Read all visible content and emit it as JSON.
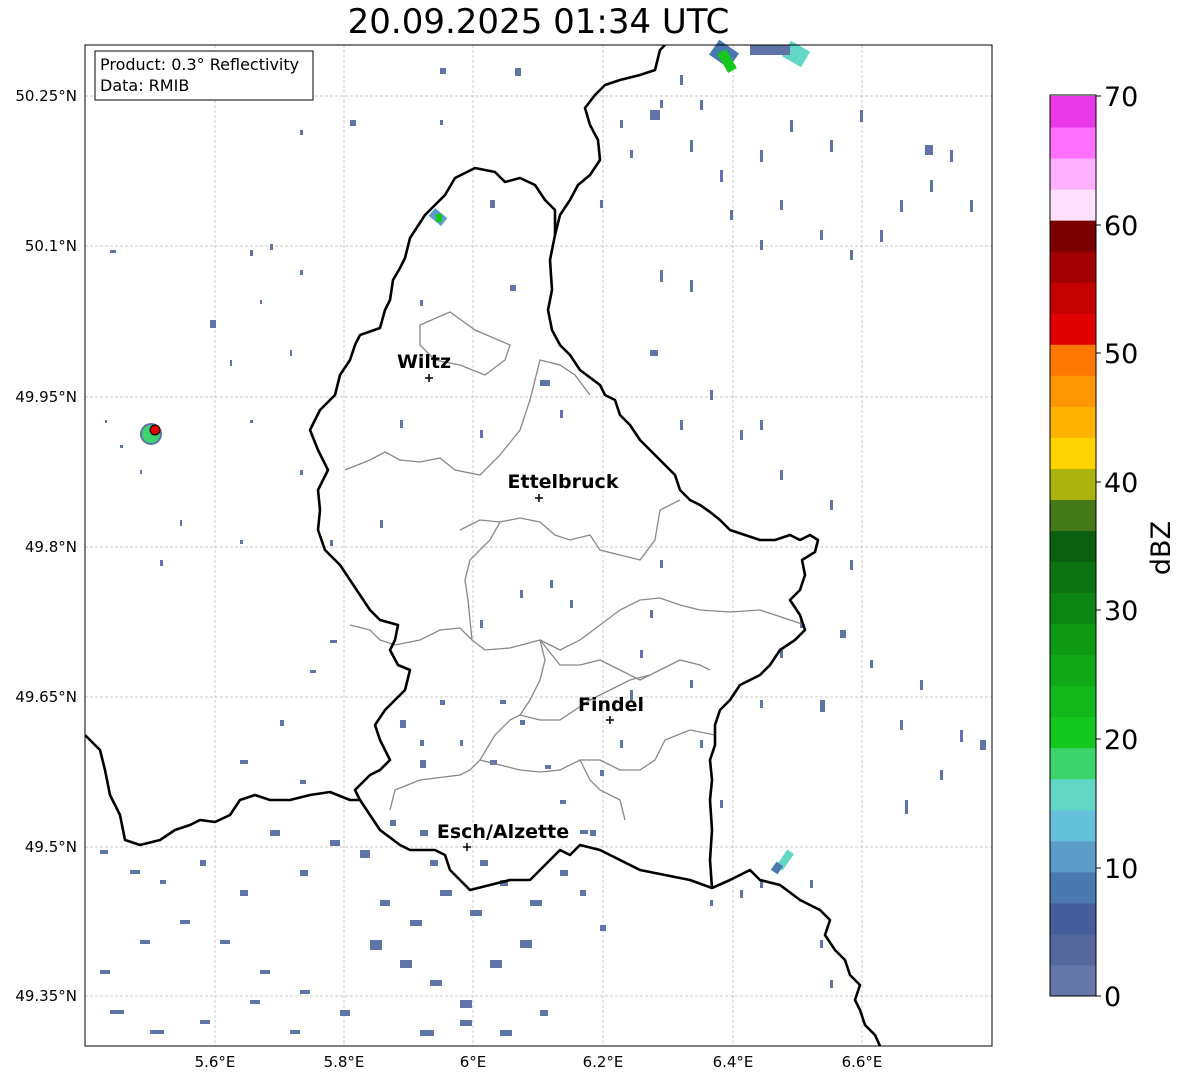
{
  "title": "20.09.2025 01:34 UTC",
  "info": {
    "product": "Product: 0.3° Reflectivity",
    "data": "Data: RMIB"
  },
  "axes": {
    "lat_ticks": [
      "50.25°N",
      "50.1°N",
      "49.95°N",
      "49.8°N",
      "49.65°N",
      "49.5°N",
      "49.35°N"
    ],
    "lon_ticks": [
      "5.6°E",
      "5.8°E",
      "6°E",
      "6.2°E",
      "6.4°E",
      "6.6°E"
    ]
  },
  "cities": [
    {
      "name": "Wiltz"
    },
    {
      "name": "Ettelbruck"
    },
    {
      "name": "Findel"
    },
    {
      "name": "Esch/Alzette"
    }
  ],
  "colorbar": {
    "label": "dBZ",
    "ticks": [
      "0",
      "10",
      "20",
      "30",
      "40",
      "50",
      "60",
      "70"
    ],
    "colors": [
      "#6477a8",
      "#55689e",
      "#465d9c",
      "#4a79b0",
      "#5b9cc8",
      "#66c2dc",
      "#62d8c4",
      "#3dd46e",
      "#14c81e",
      "#12b81a",
      "#10a816",
      "#0e9a14",
      "#0c8612",
      "#0b7410",
      "#0a600e",
      "#46791a",
      "#aab40a",
      "#ffd400",
      "#fdb300",
      "#fd9600",
      "#fd7800",
      "#e00000",
      "#c40000",
      "#a00000",
      "#7a0000",
      "#ffe0ff",
      "#ffb0ff",
      "#ff70ff",
      "#e838e8"
    ]
  }
}
